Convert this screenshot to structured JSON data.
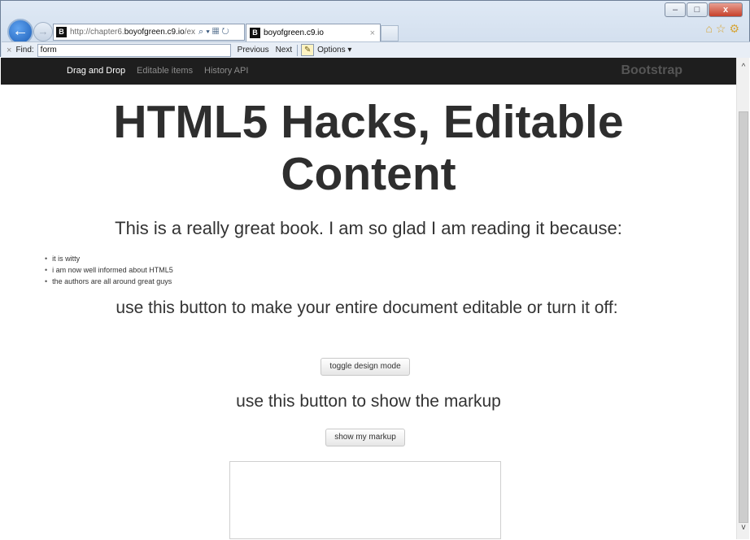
{
  "browser": {
    "address_prefix": "http://chapter6.",
    "address_domain": "boyofgreen.c9.io",
    "address_suffix": "/ex",
    "address_icons": "⌕ ▾ ▦ ↻",
    "favicon": "B",
    "tab_title": "boyofgreen.c9.io",
    "tab_close": "×",
    "right_icons": "⌂☆⚙",
    "win_minimize": "–",
    "win_maximize": "□",
    "win_close": "x"
  },
  "findbar": {
    "close": "×",
    "label": "Find:",
    "value": "form",
    "previous": "Previous",
    "next": "Next",
    "options": "Options ▾"
  },
  "navbar": {
    "items": [
      "Drag and Drop",
      "Editable items",
      "History API"
    ],
    "brand": "Bootstrap"
  },
  "page": {
    "title_line1": "HTML5 Hacks, Editable",
    "title_line2": "Content",
    "intro": "This is a really great book. I am so glad I am reading it because:",
    "reasons": [
      "it is witty",
      "i am now well informed about HTML5",
      "the authors are all around great guys"
    ],
    "design_mode_text": "use this button to make your entire document editable or turn it off:",
    "toggle_button": "toggle design mode",
    "markup_text": "use this button to show the markup",
    "markup_button": "show my markup"
  },
  "scrollbar": {
    "up": "^",
    "down": "v"
  }
}
